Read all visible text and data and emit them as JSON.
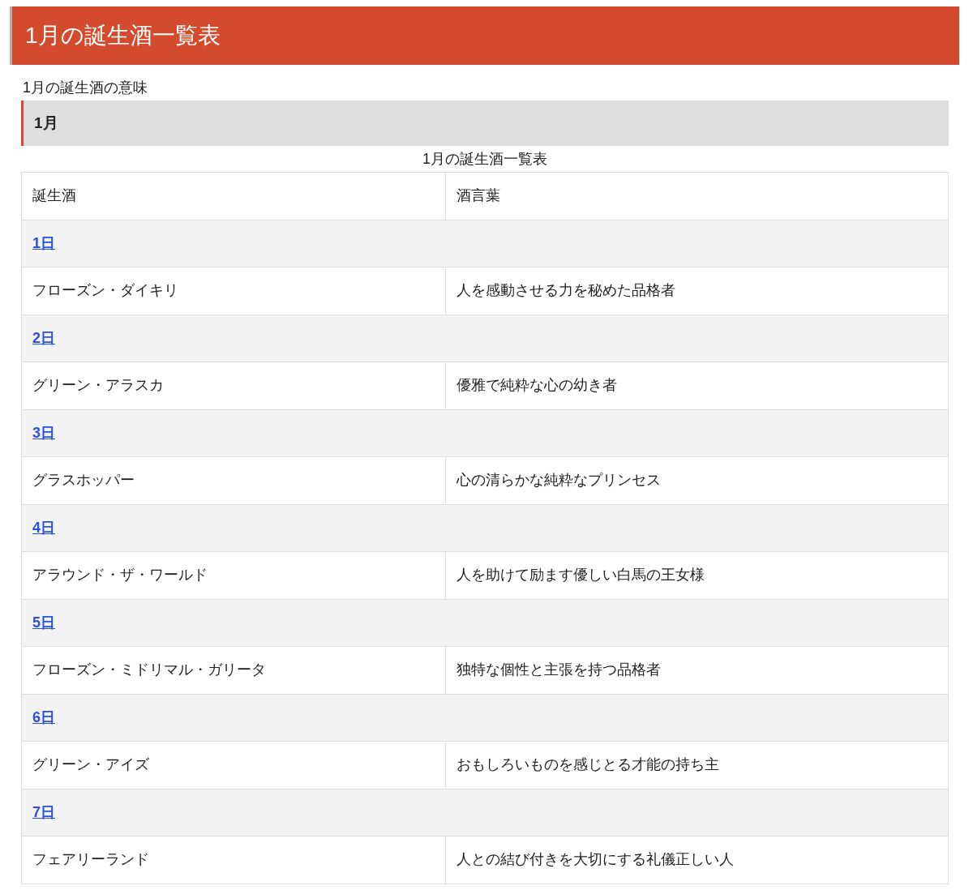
{
  "page_title": "1月の誕生酒一覧表",
  "intro": "1月の誕生酒の意味",
  "section_heading": "1月",
  "table": {
    "caption": "1月の誕生酒一覧表",
    "columns": [
      "誕生酒",
      "酒言葉"
    ],
    "rows": [
      {
        "kind": "date",
        "date": "1日"
      },
      {
        "kind": "entry",
        "cells": [
          "フローズン・ダイキリ",
          "人を感動させる力を秘めた品格者"
        ]
      },
      {
        "kind": "date",
        "date": "2日"
      },
      {
        "kind": "entry",
        "cells": [
          "グリーン・アラスカ",
          "優雅で純粋な心の幼き者"
        ]
      },
      {
        "kind": "date",
        "date": "3日"
      },
      {
        "kind": "entry",
        "cells": [
          "グラスホッパー",
          "心の清らかな純粋なプリンセス"
        ]
      },
      {
        "kind": "date",
        "date": "4日"
      },
      {
        "kind": "entry",
        "cells": [
          "アラウンド・ザ・ワールド",
          "人を助けて励ます優しい白馬の王女様"
        ]
      },
      {
        "kind": "date",
        "date": "5日"
      },
      {
        "kind": "entry",
        "cells": [
          "フローズン・ミドリマル・ガリータ",
          "独特な個性と主張を持つ品格者"
        ]
      },
      {
        "kind": "date",
        "date": "6日"
      },
      {
        "kind": "entry",
        "cells": [
          "グリーン・アイズ",
          "おもしろいものを感じとる才能の持ち主"
        ]
      },
      {
        "kind": "date",
        "date": "7日"
      },
      {
        "kind": "entry",
        "cells": [
          "フェアリーランド",
          "人との結び付きを大切にする礼儀正しい人"
        ]
      }
    ]
  }
}
